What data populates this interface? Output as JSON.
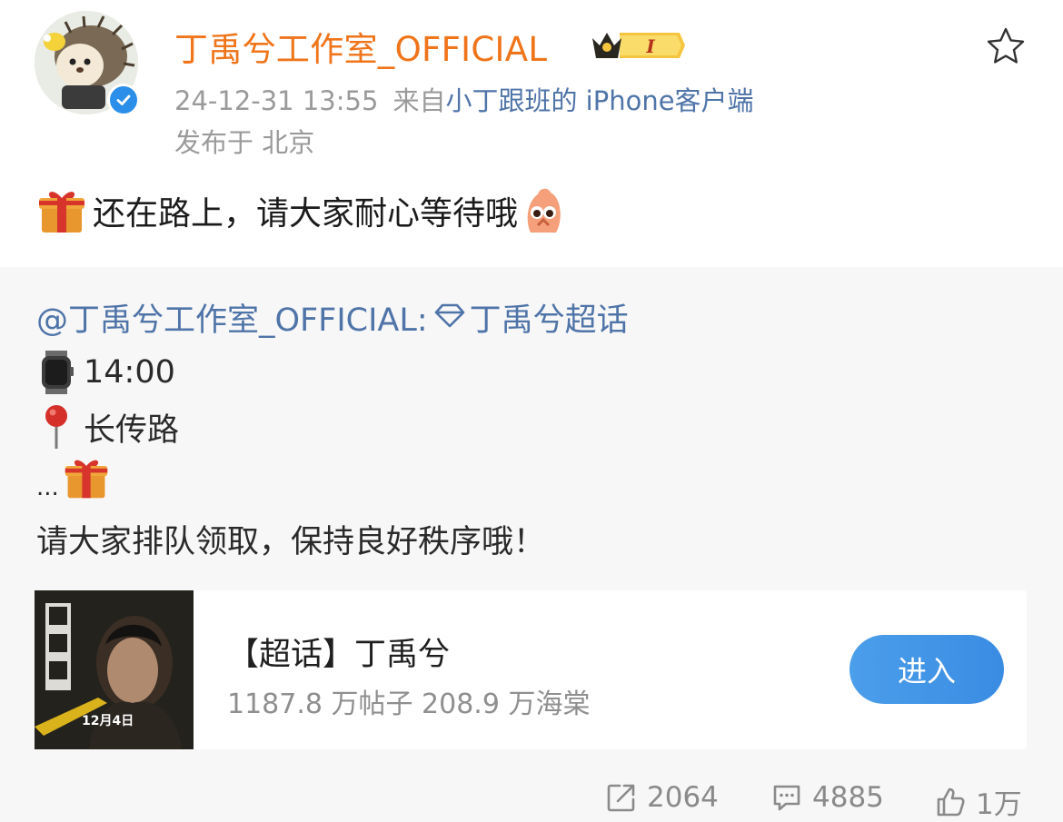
{
  "header": {
    "username": "丁禹兮工作室_OFFICIAL",
    "vip_level": "I",
    "timestamp": "24-12-31 13:55",
    "source_prefix": "来自",
    "source_name": "小丁跟班的 iPhone客户端",
    "location": "发布于 北京"
  },
  "post": {
    "text": "还在路上，请大家耐心等待哦",
    "leading_emoji": "gift-icon",
    "trailing_emoji": "pray-face-icon"
  },
  "retweet": {
    "mention": "@丁禹兮工作室_OFFICIAL:",
    "topic_link": "丁禹兮超话",
    "time": "14:00",
    "place": "长传路",
    "ellipsis": "...",
    "queue_text": "请大家排队领取，保持良好秩序哦！",
    "card": {
      "title": "【超话】丁禹兮",
      "stats": "1187.8 万帖子 208.9 万海棠",
      "enter_label": "进入",
      "poster_date": "12月4日"
    }
  },
  "actions": {
    "repost_count": "2064",
    "comment_count": "4885",
    "like_count": "1万"
  },
  "colors": {
    "username": "#f0741a",
    "link": "#4f74a8",
    "button": "#3a8ce3",
    "verified": "#2b8ee8"
  }
}
